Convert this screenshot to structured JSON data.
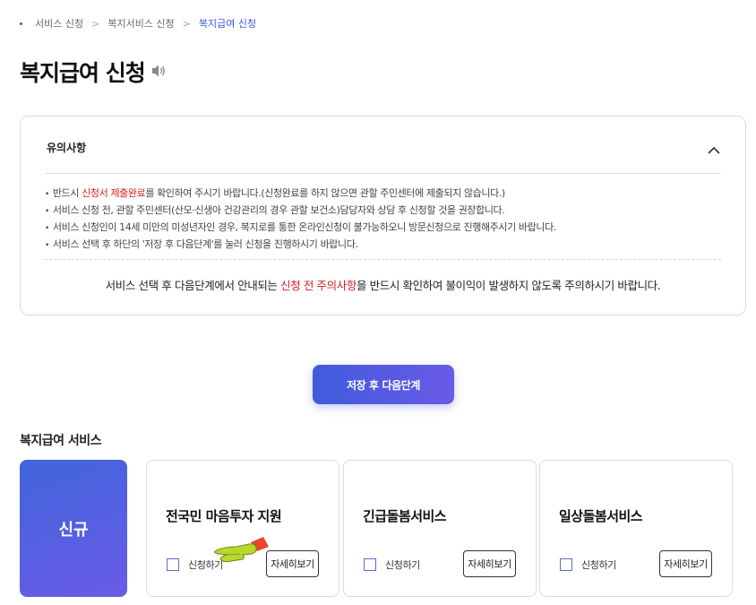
{
  "breadcrumb": {
    "items": [
      "서비스 신청",
      "복지서비스 신청"
    ],
    "current": "복지급여 신청"
  },
  "page": {
    "title": "복지급여 신청",
    "speaker_icon": "speaker-icon"
  },
  "notice": {
    "heading": "유의사항",
    "lines": [
      {
        "pre": "반드시 ",
        "highlight": "신청서 제출완료",
        "post": "를 확인하여 주시기 바랍니다.(신청완료를 하지 않으면 관할 주민센터에 제출되지 않습니다.)"
      },
      {
        "pre": "서비스 신청 전, 관할 주민센터(산모·신생아 건강관리의 경우 관할 보건소)담당자와 상담 후 신청할 것을 권장합니다.",
        "highlight": "",
        "post": ""
      },
      {
        "pre": "서비스 신청인이 14세 미만의 미성년자인 경우, 복지로를 통한 온라인신청이 불가능하오니 방문신청으로 진행해주시기 바랍니다.",
        "highlight": "",
        "post": ""
      },
      {
        "pre": "서비스 선택 후 하단의 '저장 후 다음단계'를 눌러 신청을 진행하시기 바랍니다.",
        "highlight": "",
        "post": ""
      }
    ],
    "footer": {
      "pre": "서비스 선택 후 다음단계에서 안내되는 ",
      "highlight": "신청 전 주의사항",
      "post": "을 반드시 확인하여 불이익이 발생하지 않도록 주의하시기 바랍니다."
    }
  },
  "next_button": "저장 후 다음단계",
  "services": {
    "section_title": "복지급여 서비스",
    "new_label": "신규",
    "cards": [
      {
        "title": "전국민 마음투자 지원",
        "check_label": "신청하기",
        "detail_label": "자세히보기"
      },
      {
        "title": "긴급돌봄서비스",
        "check_label": "신청하기",
        "detail_label": "자세히보기"
      },
      {
        "title": "일상돌봄서비스",
        "check_label": "신청하기",
        "detail_label": "자세히보기"
      }
    ]
  },
  "colors": {
    "accent": "#3b5bdb",
    "highlight_red": "#d6201f",
    "gradient_start": "#4065dc",
    "gradient_end": "#6a5be6"
  }
}
